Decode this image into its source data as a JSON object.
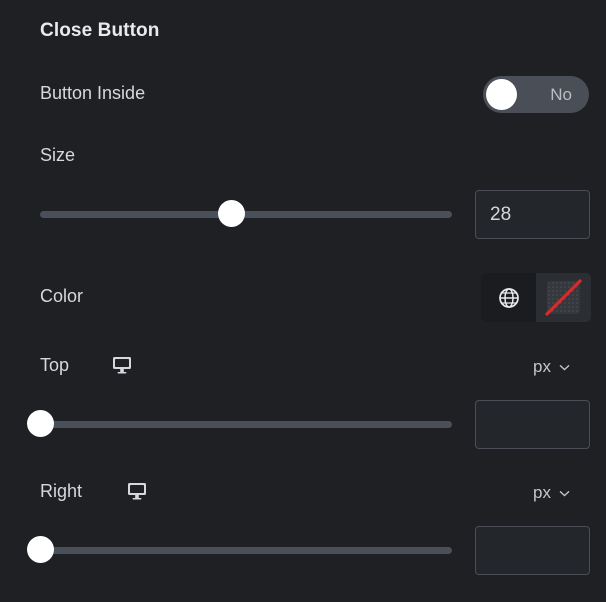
{
  "section": {
    "title": "Close Button"
  },
  "controls": {
    "button_inside": {
      "label": "Button Inside",
      "toggle_value": "No",
      "state": "off"
    },
    "size": {
      "label": "Size",
      "value": "28",
      "placeholder": "",
      "slider_percent": 46.6
    },
    "color": {
      "label": "Color",
      "globe_icon": "globe-icon",
      "swatch": "transparent-no-color"
    },
    "top": {
      "label": "Top",
      "device_icon": "desktop-icon",
      "unit": "px",
      "value": "",
      "placeholder": "",
      "slider_percent": 0
    },
    "right": {
      "label": "Right",
      "device_icon": "desktop-icon",
      "unit": "px",
      "value": "",
      "placeholder": "",
      "slider_percent": 0
    }
  },
  "colors": {
    "panel_bg": "#1e2023",
    "text_primary": "#e8eaed",
    "text_secondary": "#d5d8dc",
    "track": "#4a5059",
    "handle": "#ffffff",
    "toggle_bg": "#4a4f57",
    "input_border": "#4a4f57",
    "accent_red": "#d62b2b"
  }
}
